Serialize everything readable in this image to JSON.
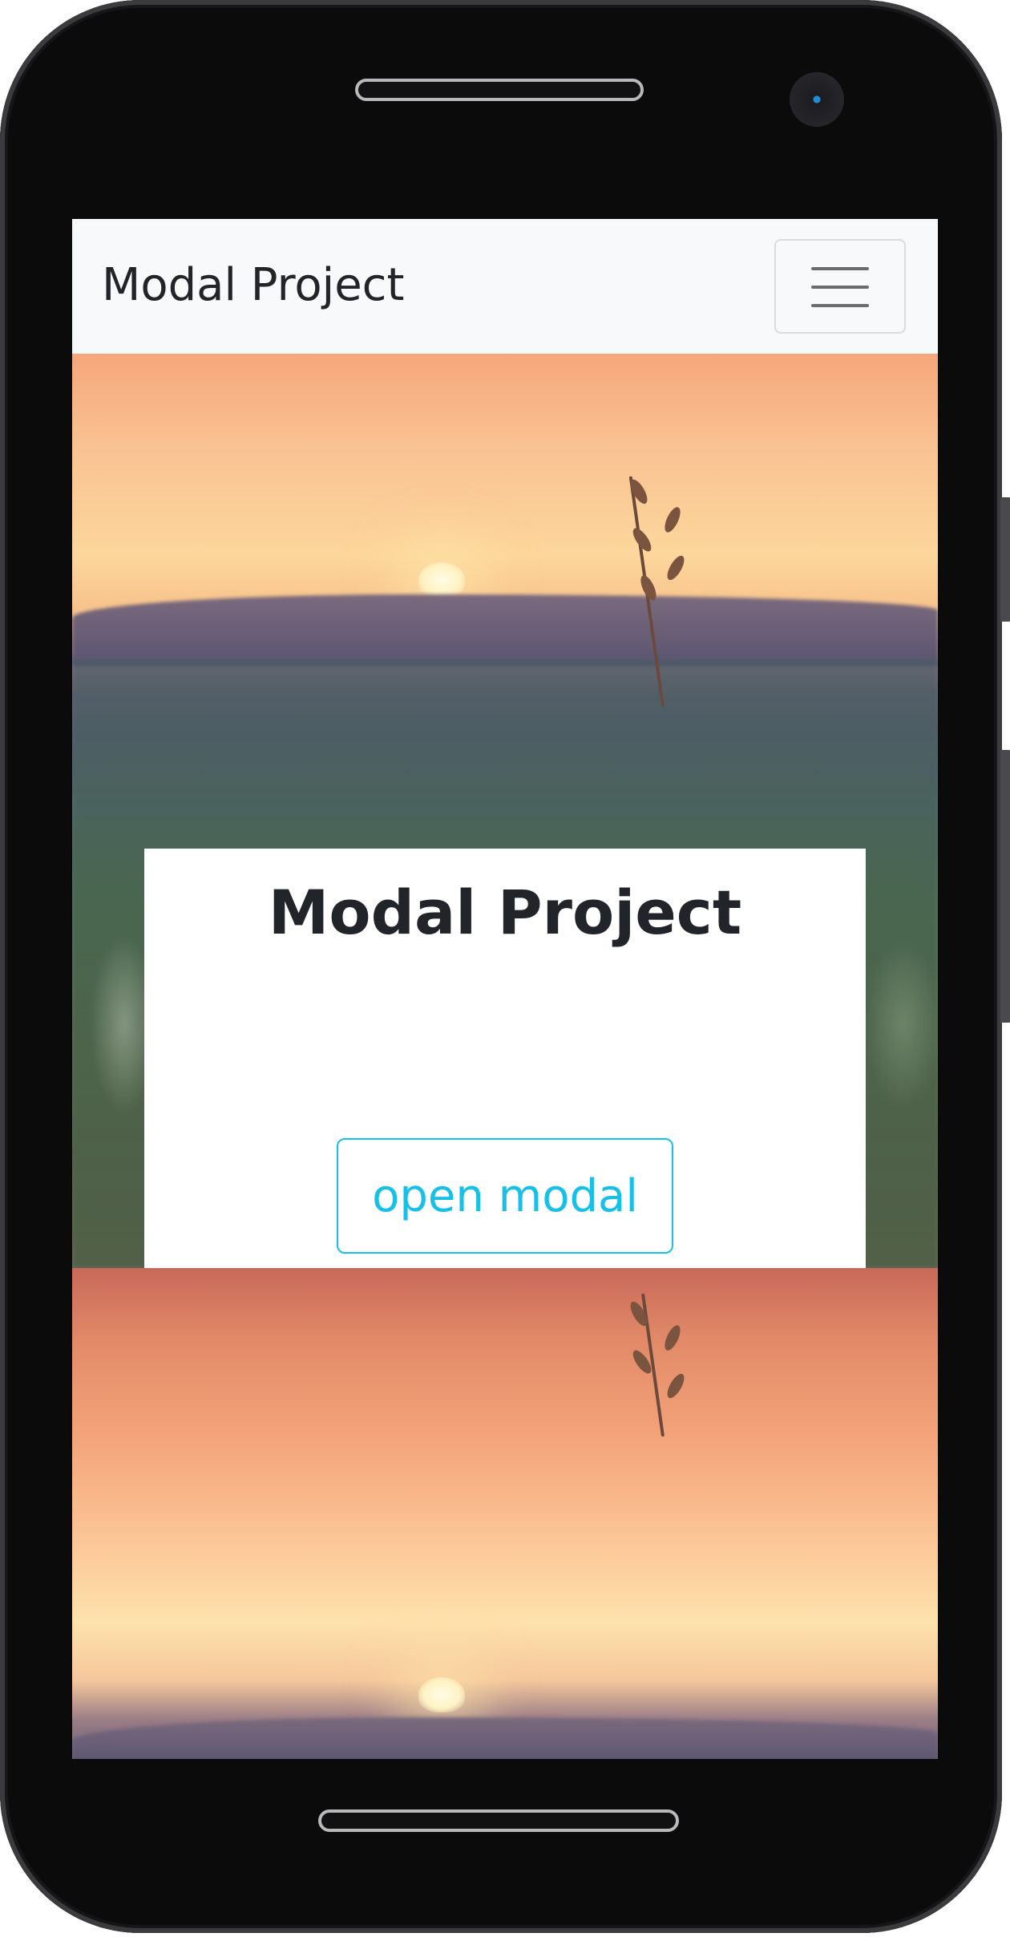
{
  "navbar": {
    "brand": "Modal Project",
    "toggler_icon": "hamburger-menu-icon"
  },
  "hero": {
    "title": "Modal Project",
    "button_label": "open modal",
    "accent_color": "#17c0e8"
  },
  "device": {
    "frame_color": "#0c0c0d"
  }
}
